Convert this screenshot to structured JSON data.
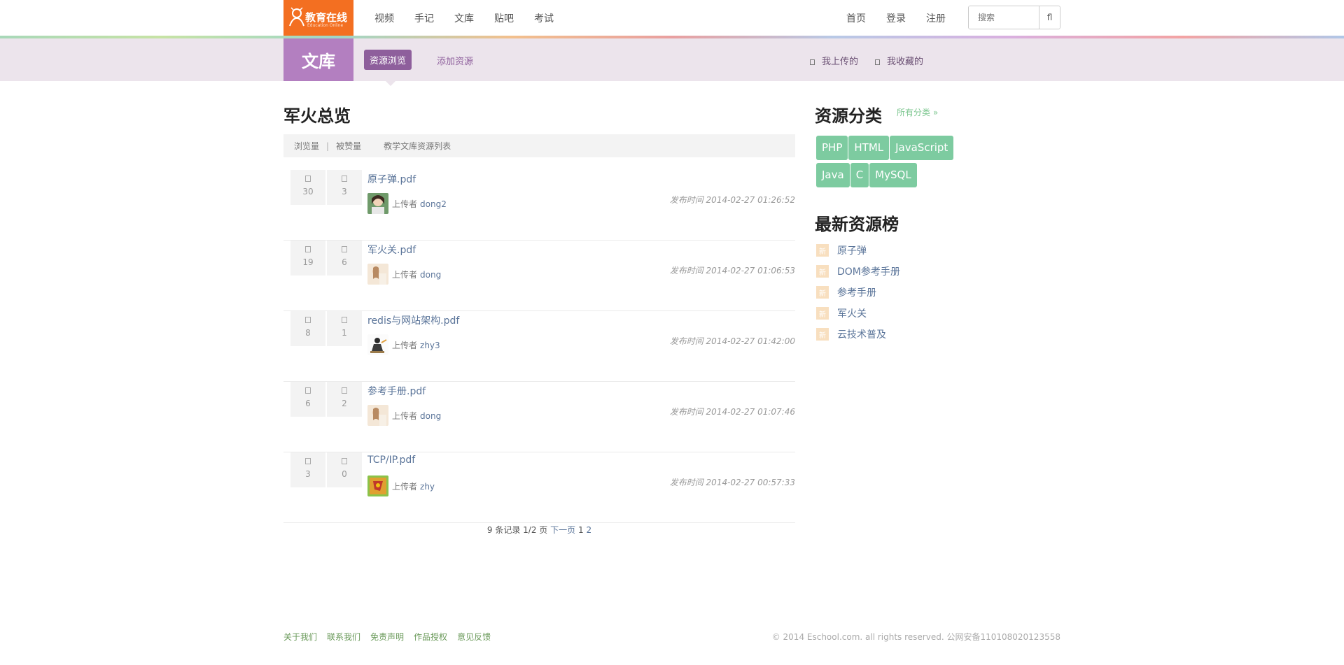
{
  "header": {
    "logo_cn": "教育在线",
    "logo_en": "Education Online",
    "nav_left": [
      "视频",
      "手记",
      "文库",
      "贴吧",
      "考试"
    ],
    "nav_right": [
      "首页",
      "登录",
      "注册"
    ],
    "search_placeholder": "搜索",
    "search_button": "fl"
  },
  "subheader": {
    "section_title": "文库",
    "tab_browse": "资源浏览",
    "tab_add": "添加资源",
    "my_uploads": "我上传的",
    "my_favorites": "我收藏的"
  },
  "main": {
    "title": "军火总览",
    "list_head": {
      "views": "浏览量",
      "sep": "|",
      "likes": "被赞量",
      "list_title": "教学文库资源列表"
    },
    "uploader_label": "上传者",
    "time_label": "发布时间",
    "rows": [
      {
        "views": "30",
        "likes": "3",
        "name": "原子弹.pdf",
        "user": "dong2",
        "time": "发布时间 2014-02-27 01:26:52"
      },
      {
        "views": "19",
        "likes": "6",
        "name": "军火关.pdf",
        "user": "dong",
        "time": "发布时间 2014-02-27 01:06:53"
      },
      {
        "views": "8",
        "likes": "1",
        "name": "redis与网站架构.pdf",
        "user": "zhy3",
        "time": "发布时间 2014-02-27 01:42:00"
      },
      {
        "views": "6",
        "likes": "2",
        "name": "参考手册.pdf",
        "user": "dong",
        "time": "发布时间 2014-02-27 01:07:46"
      },
      {
        "views": "3",
        "likes": "0",
        "name": "TCP/IP.pdf",
        "user": "zhy",
        "time": "发布时间 2014-02-27 00:57:33"
      }
    ],
    "pager": {
      "summary": "9 条记录 1/2 页",
      "next": "下一页",
      "page1": "1",
      "page2": "2"
    }
  },
  "sidebar": {
    "category_title": "资源分类",
    "all_categories": "所有分类 »",
    "tags": [
      "PHP",
      "HTML",
      "JavaScript",
      "Java",
      "C",
      "MySQL"
    ],
    "new_title": "最新资源榜",
    "new_badge": "新",
    "new_items": [
      "原子弹",
      "DOM参考手册",
      "参考手册",
      "军火关",
      "云技术普及"
    ]
  },
  "footer": {
    "links": [
      "关于我们",
      "联系我们",
      "免责声明",
      "作品授权",
      "意见反馈"
    ],
    "copyright": "© 2014 Eschool.com. all rights reserved. 公网安备110108020123558"
  },
  "colors": {
    "logo_bg": "#f36f21",
    "section_bg": "#b37fc0",
    "subbar_bg": "#ece4ec",
    "tab_active": "#8e5f9c",
    "tag_bg": "#7dcba0",
    "link": "#5a7499"
  },
  "icons": {
    "logo": "bee-logo-icon",
    "search": "search-icon",
    "stat_views": "eye-icon",
    "stat_likes": "thumb-icon",
    "my_uploads": "upload-icon",
    "my_favorites": "star-icon"
  }
}
